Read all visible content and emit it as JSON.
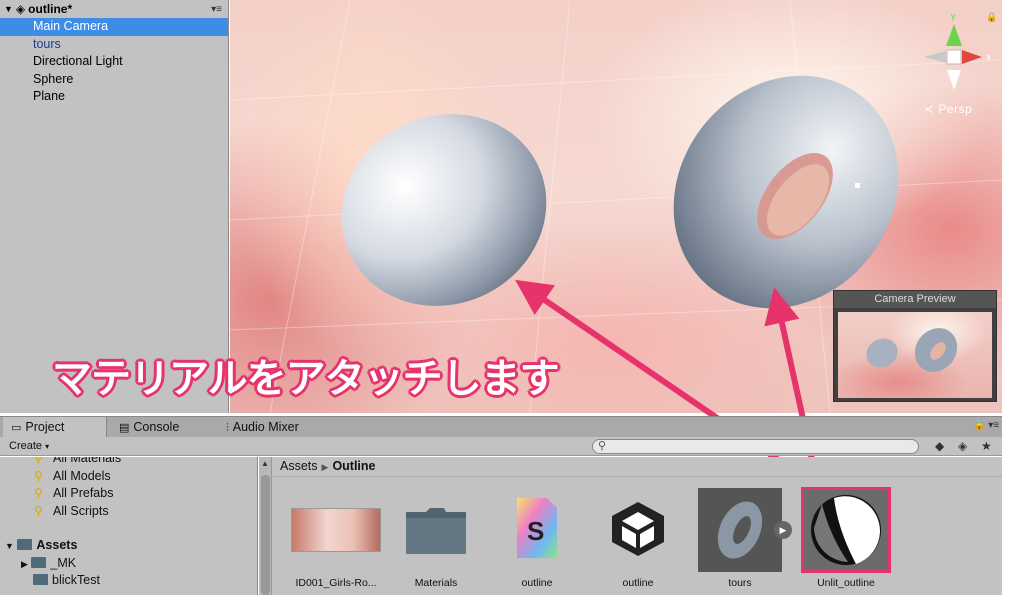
{
  "hierarchy": {
    "scene_name": "outline*",
    "items": [
      {
        "label": "Main Camera"
      },
      {
        "label": "tours"
      },
      {
        "label": "Directional Light"
      },
      {
        "label": "Sphere"
      },
      {
        "label": "Plane"
      }
    ]
  },
  "scene": {
    "persp_label": "Persp",
    "gizmo": {
      "y": "y",
      "x": "x"
    },
    "camera_preview_title": "Camera Preview"
  },
  "annotation": {
    "text": "マテリアルをアタッチします",
    "color": "#e6336b"
  },
  "tabs": {
    "project": "Project",
    "console": "Console",
    "audio_mixer": "Audio Mixer"
  },
  "toolbar": {
    "create_label": "Create",
    "search_placeholder": ""
  },
  "favorites": [
    {
      "label": "All Materials"
    },
    {
      "label": "All Models"
    },
    {
      "label": "All Prefabs"
    },
    {
      "label": "All Scripts"
    }
  ],
  "assets_tree": {
    "root": "Assets",
    "children": [
      {
        "label": "_MK"
      },
      {
        "label": "blickTest"
      }
    ]
  },
  "breadcrumb": {
    "root": "Assets",
    "current": "Outline"
  },
  "assets": [
    {
      "label": "ID001_Girls-Ro..."
    },
    {
      "label": "Materials"
    },
    {
      "label": "outline"
    },
    {
      "label": "outline"
    },
    {
      "label": "tours"
    },
    {
      "label": "Unlit_outline"
    }
  ],
  "colors": {
    "selection": "#3d8ce6",
    "panel": "#c2c2c2",
    "highlight_border": "#e6336b"
  }
}
